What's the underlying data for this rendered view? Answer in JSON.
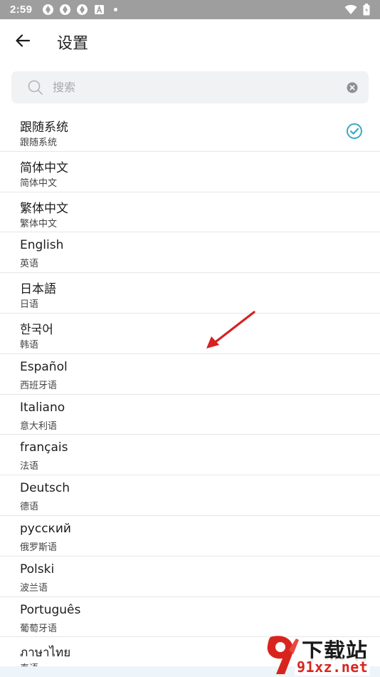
{
  "status_bar": {
    "time": "2:59",
    "notification_icons": [
      "app-notification-icon",
      "app-notification-icon",
      "app-notification-icon",
      "a-notification-icon"
    ]
  },
  "app_bar": {
    "title": "设置"
  },
  "search": {
    "placeholder": "搜索",
    "value": ""
  },
  "languages": [
    {
      "name": "跟随系统",
      "native": "跟随系统",
      "selected": true
    },
    {
      "name": "简体中文",
      "native": "简体中文",
      "selected": false
    },
    {
      "name": "繁体中文",
      "native": "繁体中文",
      "selected": false
    },
    {
      "name": "English",
      "native": "英语",
      "selected": false
    },
    {
      "name": "日本語",
      "native": "日语",
      "selected": false
    },
    {
      "name": "한국어",
      "native": "韩语",
      "selected": false
    },
    {
      "name": "Español",
      "native": "西班牙语",
      "selected": false
    },
    {
      "name": "Italiano",
      "native": "意大利语",
      "selected": false
    },
    {
      "name": "français",
      "native": "法语",
      "selected": false
    },
    {
      "name": "Deutsch",
      "native": "德语",
      "selected": false
    },
    {
      "name": "русский",
      "native": "俄罗斯语",
      "selected": false
    },
    {
      "name": "Polski",
      "native": "波兰语",
      "selected": false
    },
    {
      "name": "Português",
      "native": "葡萄牙语",
      "selected": false
    },
    {
      "name": "ภาษาไทย",
      "native": "泰语",
      "selected": false
    }
  ],
  "colors": {
    "accent": "#35a9c4",
    "arrow": "#d62222",
    "status_bar": "#9e9e9e"
  },
  "watermark": {
    "top": "下载站",
    "bottom": "91xz.net"
  }
}
